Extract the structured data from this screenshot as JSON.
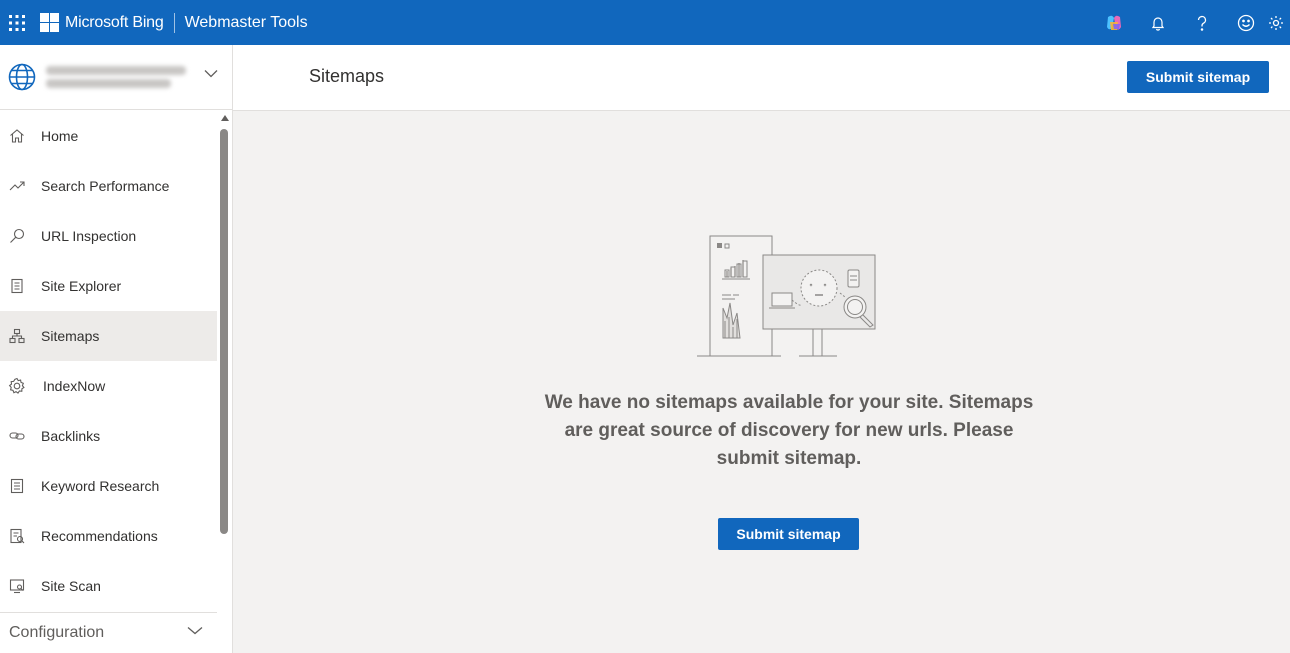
{
  "topbar": {
    "brand": "Microsoft Bing",
    "product": "Webmaster Tools",
    "icons": [
      "waffle-icon",
      "copilot-icon",
      "bell-icon",
      "help-icon",
      "smiley-icon",
      "gear-icon"
    ],
    "accent": "#1167bd"
  },
  "sidebar": {
    "site_selector": {
      "icon": "globe-icon",
      "line1": "",
      "line2": ""
    },
    "items": [
      {
        "label": "Home",
        "icon": "home-icon"
      },
      {
        "label": "Search Performance",
        "icon": "trend-icon"
      },
      {
        "label": "URL Inspection",
        "icon": "search-icon"
      },
      {
        "label": "Site Explorer",
        "icon": "document-icon"
      },
      {
        "label": "Sitemaps",
        "icon": "sitemap-icon",
        "active": true
      },
      {
        "label": "IndexNow",
        "icon": "gear-icon"
      },
      {
        "label": "Backlinks",
        "icon": "link-icon"
      },
      {
        "label": "Keyword Research",
        "icon": "list-icon"
      },
      {
        "label": "Recommendations",
        "icon": "recommend-icon"
      },
      {
        "label": "Site Scan",
        "icon": "scan-icon"
      }
    ],
    "configuration": "Configuration"
  },
  "header": {
    "title": "Sitemaps",
    "submit_label": "Submit sitemap"
  },
  "main": {
    "empty_message": "We have no sitemaps available for your site. Sitemaps are great source of discovery for new urls. Please submit sitemap.",
    "submit_label": "Submit sitemap"
  }
}
